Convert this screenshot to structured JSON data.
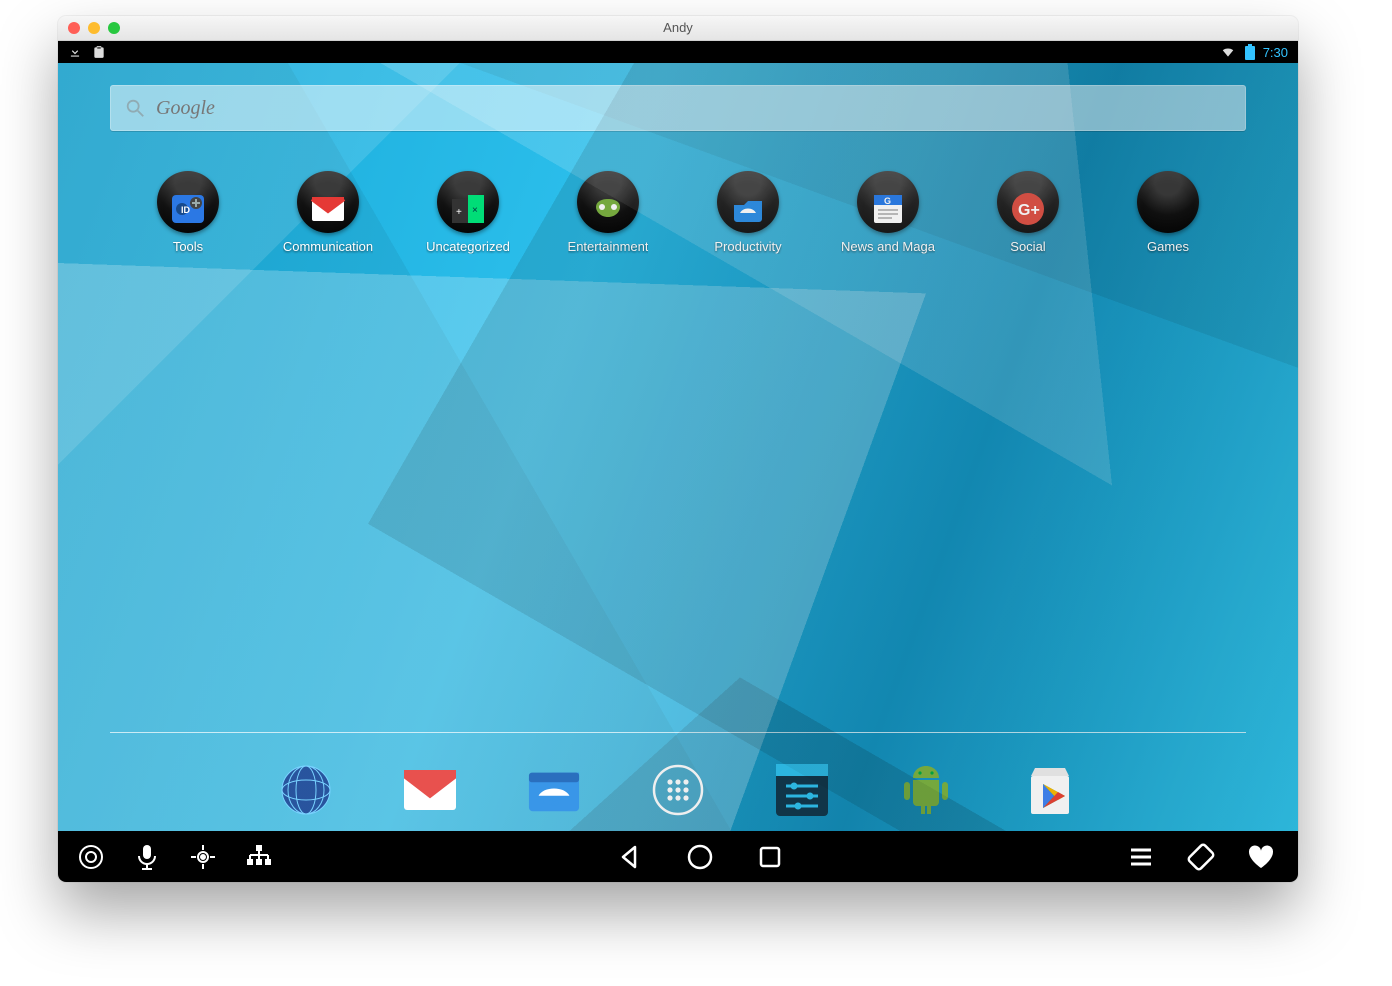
{
  "window": {
    "title": "Andy"
  },
  "status": {
    "time": "7:30"
  },
  "search": {
    "placeholder": "Google"
  },
  "folders": [
    {
      "id": "tools",
      "label": "Tools"
    },
    {
      "id": "communication",
      "label": "Communication"
    },
    {
      "id": "uncategorized",
      "label": "Uncategorized"
    },
    {
      "id": "entertainment",
      "label": "Entertainment"
    },
    {
      "id": "productivity",
      "label": "Productivity"
    },
    {
      "id": "news",
      "label": "News and Maga"
    },
    {
      "id": "social",
      "label": "Social"
    },
    {
      "id": "games",
      "label": "Games"
    }
  ],
  "dock": [
    {
      "id": "browser",
      "name": "browser-app"
    },
    {
      "id": "gmail",
      "name": "gmail-app"
    },
    {
      "id": "filemanager",
      "name": "es-file-explorer-app"
    },
    {
      "id": "appdrawer",
      "name": "app-drawer-button"
    },
    {
      "id": "settings",
      "name": "settings-app"
    },
    {
      "id": "android",
      "name": "android-app"
    },
    {
      "id": "playstore",
      "name": "play-store-app"
    }
  ]
}
